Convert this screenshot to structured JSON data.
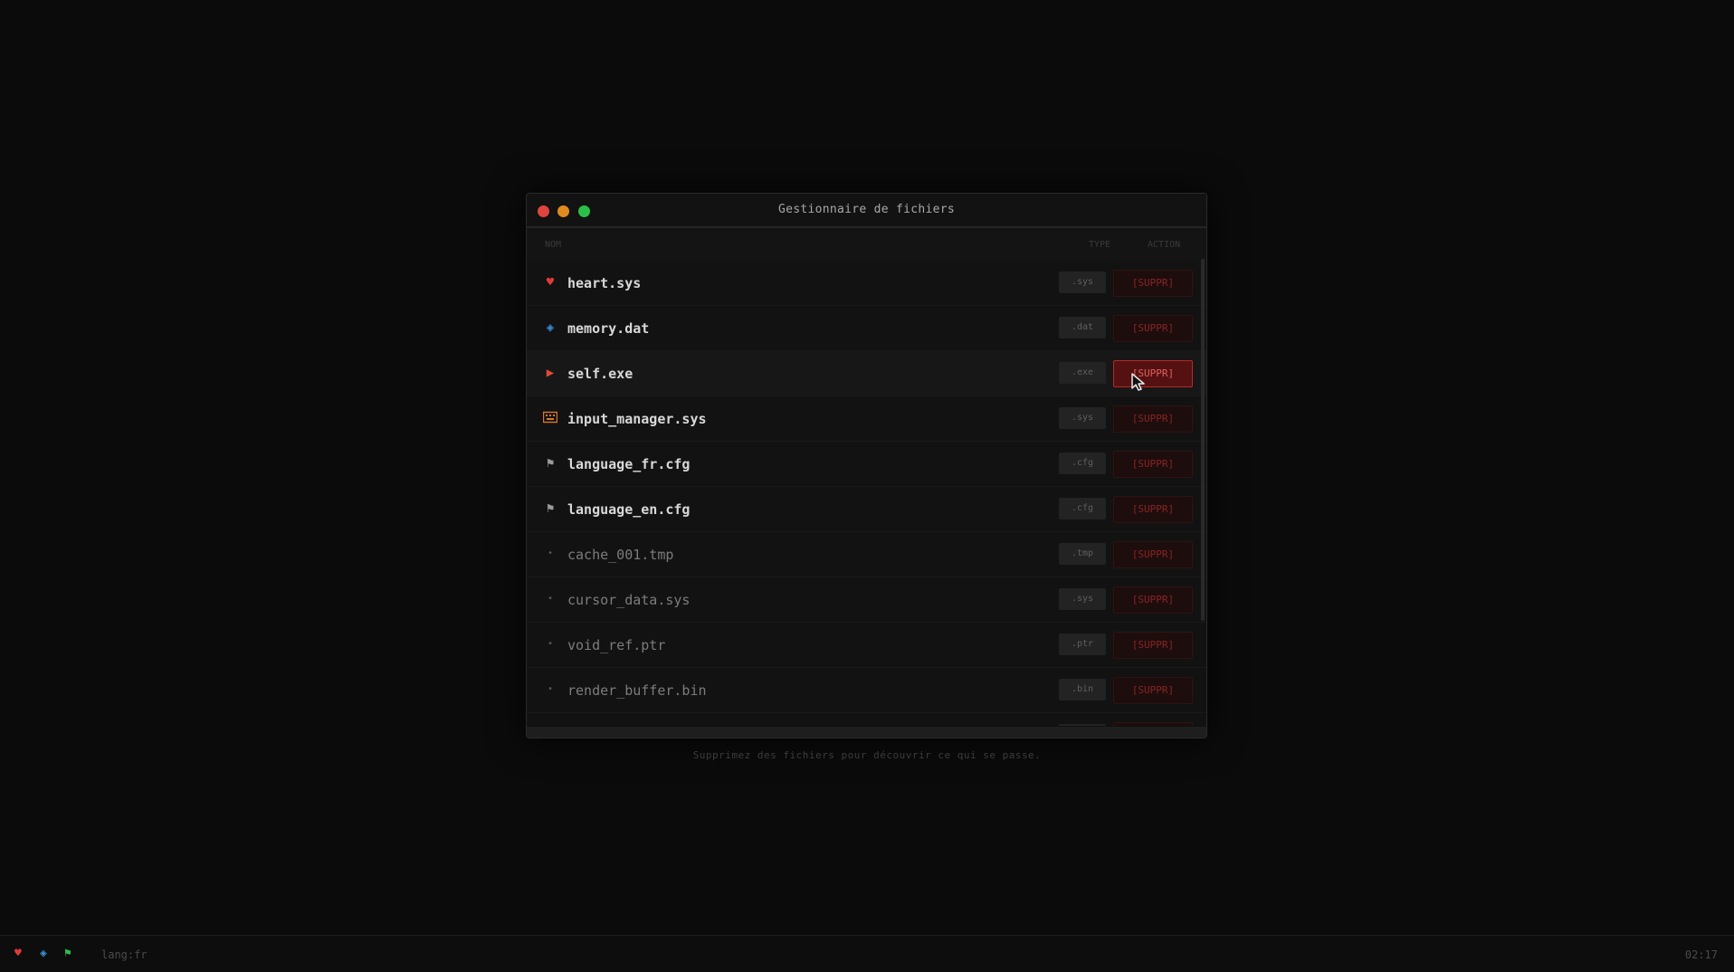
{
  "window": {
    "title": "Gestionnaire de fichiers"
  },
  "columns": {
    "name": "NOM",
    "type": "TYPE",
    "action": "ACTION"
  },
  "files": [
    {
      "name": "heart.sys",
      "ext": ".sys",
      "action": "[SUPPR]",
      "icon": "heart-icon"
    },
    {
      "name": "memory.dat",
      "ext": ".dat",
      "action": "[SUPPR]",
      "icon": "diamond-icon"
    },
    {
      "name": "self.exe",
      "ext": ".exe",
      "action": "[SUPPR]",
      "icon": "play-icon"
    },
    {
      "name": "input_manager.sys",
      "ext": ".sys",
      "action": "[SUPPR]",
      "icon": "keyboard-icon"
    },
    {
      "name": "language_fr.cfg",
      "ext": ".cfg",
      "action": "[SUPPR]",
      "icon": "flag-icon"
    },
    {
      "name": "language_en.cfg",
      "ext": ".cfg",
      "action": "[SUPPR]",
      "icon": "flag-icon"
    },
    {
      "name": "cache_001.tmp",
      "ext": ".tmp",
      "action": "[SUPPR]",
      "icon": "dot-icon"
    },
    {
      "name": "cursor_data.sys",
      "ext": ".sys",
      "action": "[SUPPR]",
      "icon": "dot-icon"
    },
    {
      "name": "void_ref.ptr",
      "ext": ".ptr",
      "action": "[SUPPR]",
      "icon": "dot-icon"
    },
    {
      "name": "render_buffer.bin",
      "ext": ".bin",
      "action": "[SUPPR]",
      "icon": "dot-icon"
    }
  ],
  "hint": "Supprimez des fichiers pour découvrir ce qui se passe.",
  "taskbar": {
    "icons": [
      "heart-icon",
      "diamond-icon",
      "flag-icon"
    ],
    "lang": "lang:fr",
    "clock": "02:17"
  },
  "colors": {
    "heart": "#e03a3a",
    "diamond": "#3a8fd8",
    "play": "#e04a3a",
    "keyboard": "#d8782a",
    "flag": "#9a9a9a",
    "flag_taskbar": "#2bbf4a",
    "delete_text": "#8a2424"
  }
}
